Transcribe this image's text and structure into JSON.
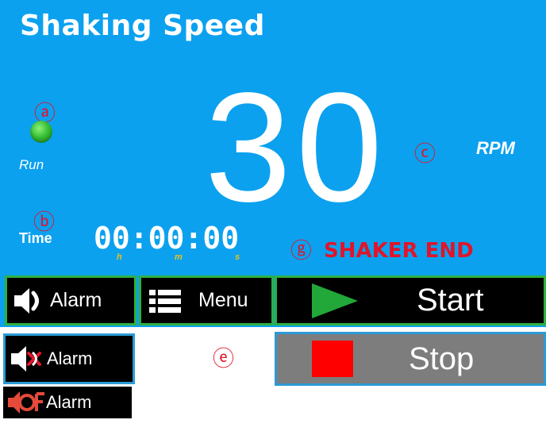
{
  "header": {
    "title": "Shaking Speed"
  },
  "indicator": {
    "run_label": "Run"
  },
  "speed": {
    "value": "30",
    "unit": "RPM"
  },
  "timer": {
    "label": "Time",
    "hours": "00",
    "minutes": "00",
    "seconds": "00",
    "sep": ":",
    "unit_h": "h",
    "unit_m": "m",
    "unit_s": "s"
  },
  "markers": {
    "a": "ⓐ",
    "b": "ⓑ",
    "c": "ⓒ",
    "e": "ⓔ",
    "g": "ⓖ"
  },
  "status": {
    "text": "SHAKER END",
    "color": "#e0142a"
  },
  "buttons": {
    "alarm": "Alarm",
    "menu": "Menu",
    "start": "Start",
    "alarm_muted": "Alarm",
    "stop": "Stop",
    "alarm_off": "Alarm"
  },
  "icons": {
    "speaker": "speaker-icon",
    "menu": "list-menu-icon",
    "start": "play-triangle-icon",
    "muted": "speaker-muted-icon",
    "stop": "stop-square-icon",
    "alarm_off": "alarm-off-icon"
  },
  "colors": {
    "panel": "#0ba1ef",
    "button_border": "#2eb040",
    "start_triangle": "#21a838",
    "stop_square": "#ff0000",
    "led": "#37c237",
    "time_units": "#e8c11a"
  }
}
